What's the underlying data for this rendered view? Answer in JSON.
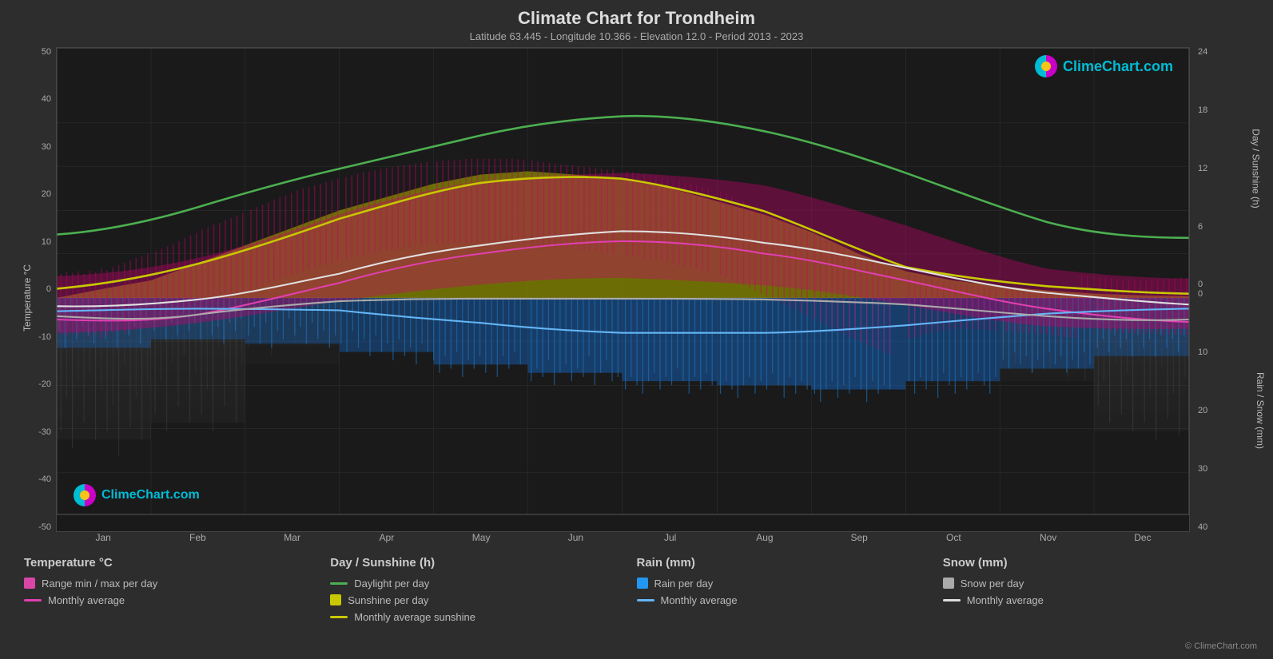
{
  "title": "Climate Chart for Trondheim",
  "subtitle": "Latitude 63.445 - Longitude 10.366 - Elevation 12.0 - Period 2013 - 2023",
  "logo_text": "ClimeChart.com",
  "copyright": "© ClimeChart.com",
  "y_axis_left": {
    "label": "Temperature °C",
    "ticks": [
      "50",
      "40",
      "30",
      "20",
      "10",
      "0",
      "-10",
      "-20",
      "-30",
      "-40",
      "-50"
    ]
  },
  "y_axis_right_top": {
    "label": "Day / Sunshine (h)",
    "ticks": [
      "24",
      "18",
      "12",
      "6",
      "0"
    ]
  },
  "y_axis_right_bottom": {
    "label": "Rain / Snow (mm)",
    "ticks": [
      "0",
      "10",
      "20",
      "30",
      "40"
    ]
  },
  "x_axis": {
    "months": [
      "Jan",
      "Feb",
      "Mar",
      "Apr",
      "May",
      "Jun",
      "Jul",
      "Aug",
      "Sep",
      "Oct",
      "Nov",
      "Dec"
    ]
  },
  "legend": {
    "columns": [
      {
        "title": "Temperature °C",
        "items": [
          {
            "type": "box",
            "color": "#d946a8",
            "label": "Range min / max per day"
          },
          {
            "type": "line",
            "color": "#d946a8",
            "label": "Monthly average"
          }
        ]
      },
      {
        "title": "Day / Sunshine (h)",
        "items": [
          {
            "type": "line",
            "color": "#4caf50",
            "label": "Daylight per day"
          },
          {
            "type": "box",
            "color": "#c8c800",
            "label": "Sunshine per day"
          },
          {
            "type": "line",
            "color": "#c8c800",
            "label": "Monthly average sunshine"
          }
        ]
      },
      {
        "title": "Rain (mm)",
        "items": [
          {
            "type": "box",
            "color": "#2196f3",
            "label": "Rain per day"
          },
          {
            "type": "line",
            "color": "#64b5f6",
            "label": "Monthly average"
          }
        ]
      },
      {
        "title": "Snow (mm)",
        "items": [
          {
            "type": "box",
            "color": "#aaaaaa",
            "label": "Snow per day"
          },
          {
            "type": "line",
            "color": "#dddddd",
            "label": "Monthly average"
          }
        ]
      }
    ]
  }
}
